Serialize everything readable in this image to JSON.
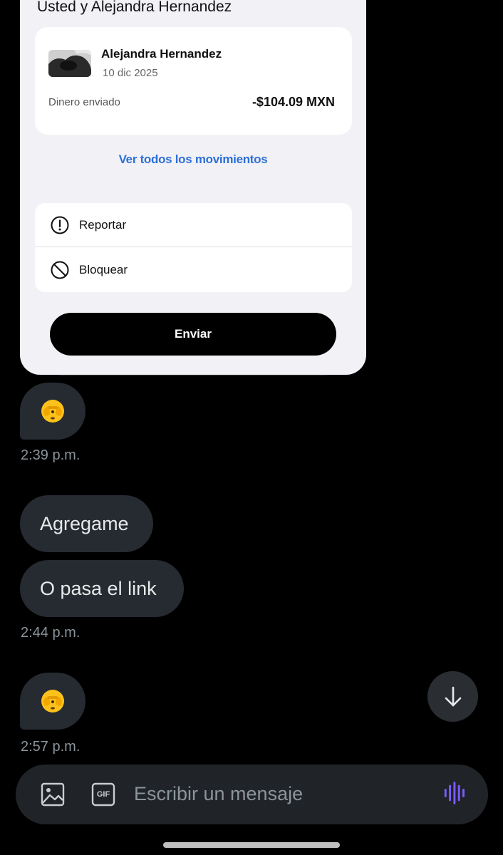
{
  "card": {
    "header": "Usted y Alejandra Hernandez",
    "transaction": {
      "name": "Alejandra Hernandez",
      "date": "10 dic 2025",
      "label": "Dinero enviado",
      "amount": "-$104.09 MXN"
    },
    "view_all_link": "Ver todos los movimientos",
    "actions": [
      {
        "label": "Reportar",
        "icon": "alert-circle-icon"
      },
      {
        "label": "Bloquear",
        "icon": "block-icon"
      }
    ],
    "send_button": "Enviar"
  },
  "messages": [
    {
      "type": "emoji",
      "content": "face-with-peeking-eye-emoji",
      "time": "2:39 p.m."
    },
    {
      "type": "text",
      "content": "Agregame"
    },
    {
      "type": "text",
      "content": "O pasa el link",
      "time": "2:44 p.m."
    },
    {
      "type": "emoji",
      "content": "face-with-peeking-eye-emoji",
      "time": "2:57 p.m."
    }
  ],
  "composer": {
    "placeholder": "Escribir un mensaje",
    "icons": [
      "image-icon",
      "gif-icon",
      "voice-icon"
    ],
    "gif_label": "GIF"
  },
  "colors": {
    "background": "#000000",
    "bubble": "#262b31",
    "link": "#2e6fd6",
    "voice_accent": "#7b5cff"
  }
}
